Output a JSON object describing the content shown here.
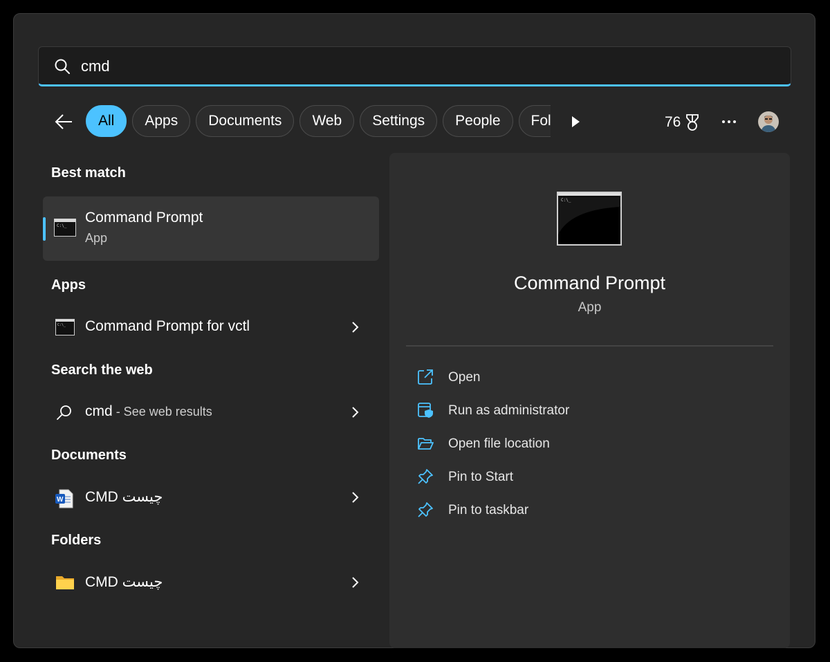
{
  "search": {
    "query": "cmd"
  },
  "filters": [
    "All",
    "Apps",
    "Documents",
    "Web",
    "Settings",
    "People",
    "Fold"
  ],
  "points": "76",
  "sections": {
    "best_match": "Best match",
    "apps": "Apps",
    "web": "Search the web",
    "documents": "Documents",
    "folders": "Folders"
  },
  "best_match": {
    "name": "Command Prompt",
    "type": "App"
  },
  "apps_results": [
    {
      "name": "Command Prompt for vctl"
    }
  ],
  "web_result": {
    "query": "cmd",
    "suffix": " - See web results"
  },
  "document_result": {
    "name": "CMD چیست"
  },
  "folder_result": {
    "name": "CMD چیست"
  },
  "preview": {
    "title": "Command Prompt",
    "subtitle": "App",
    "actions": [
      "Open",
      "Run as administrator",
      "Open file location",
      "Pin to Start",
      "Pin to taskbar"
    ]
  },
  "colors": {
    "accent": "#4cc2ff",
    "panel": "#262626",
    "preview_bg": "#2e2e2e"
  }
}
